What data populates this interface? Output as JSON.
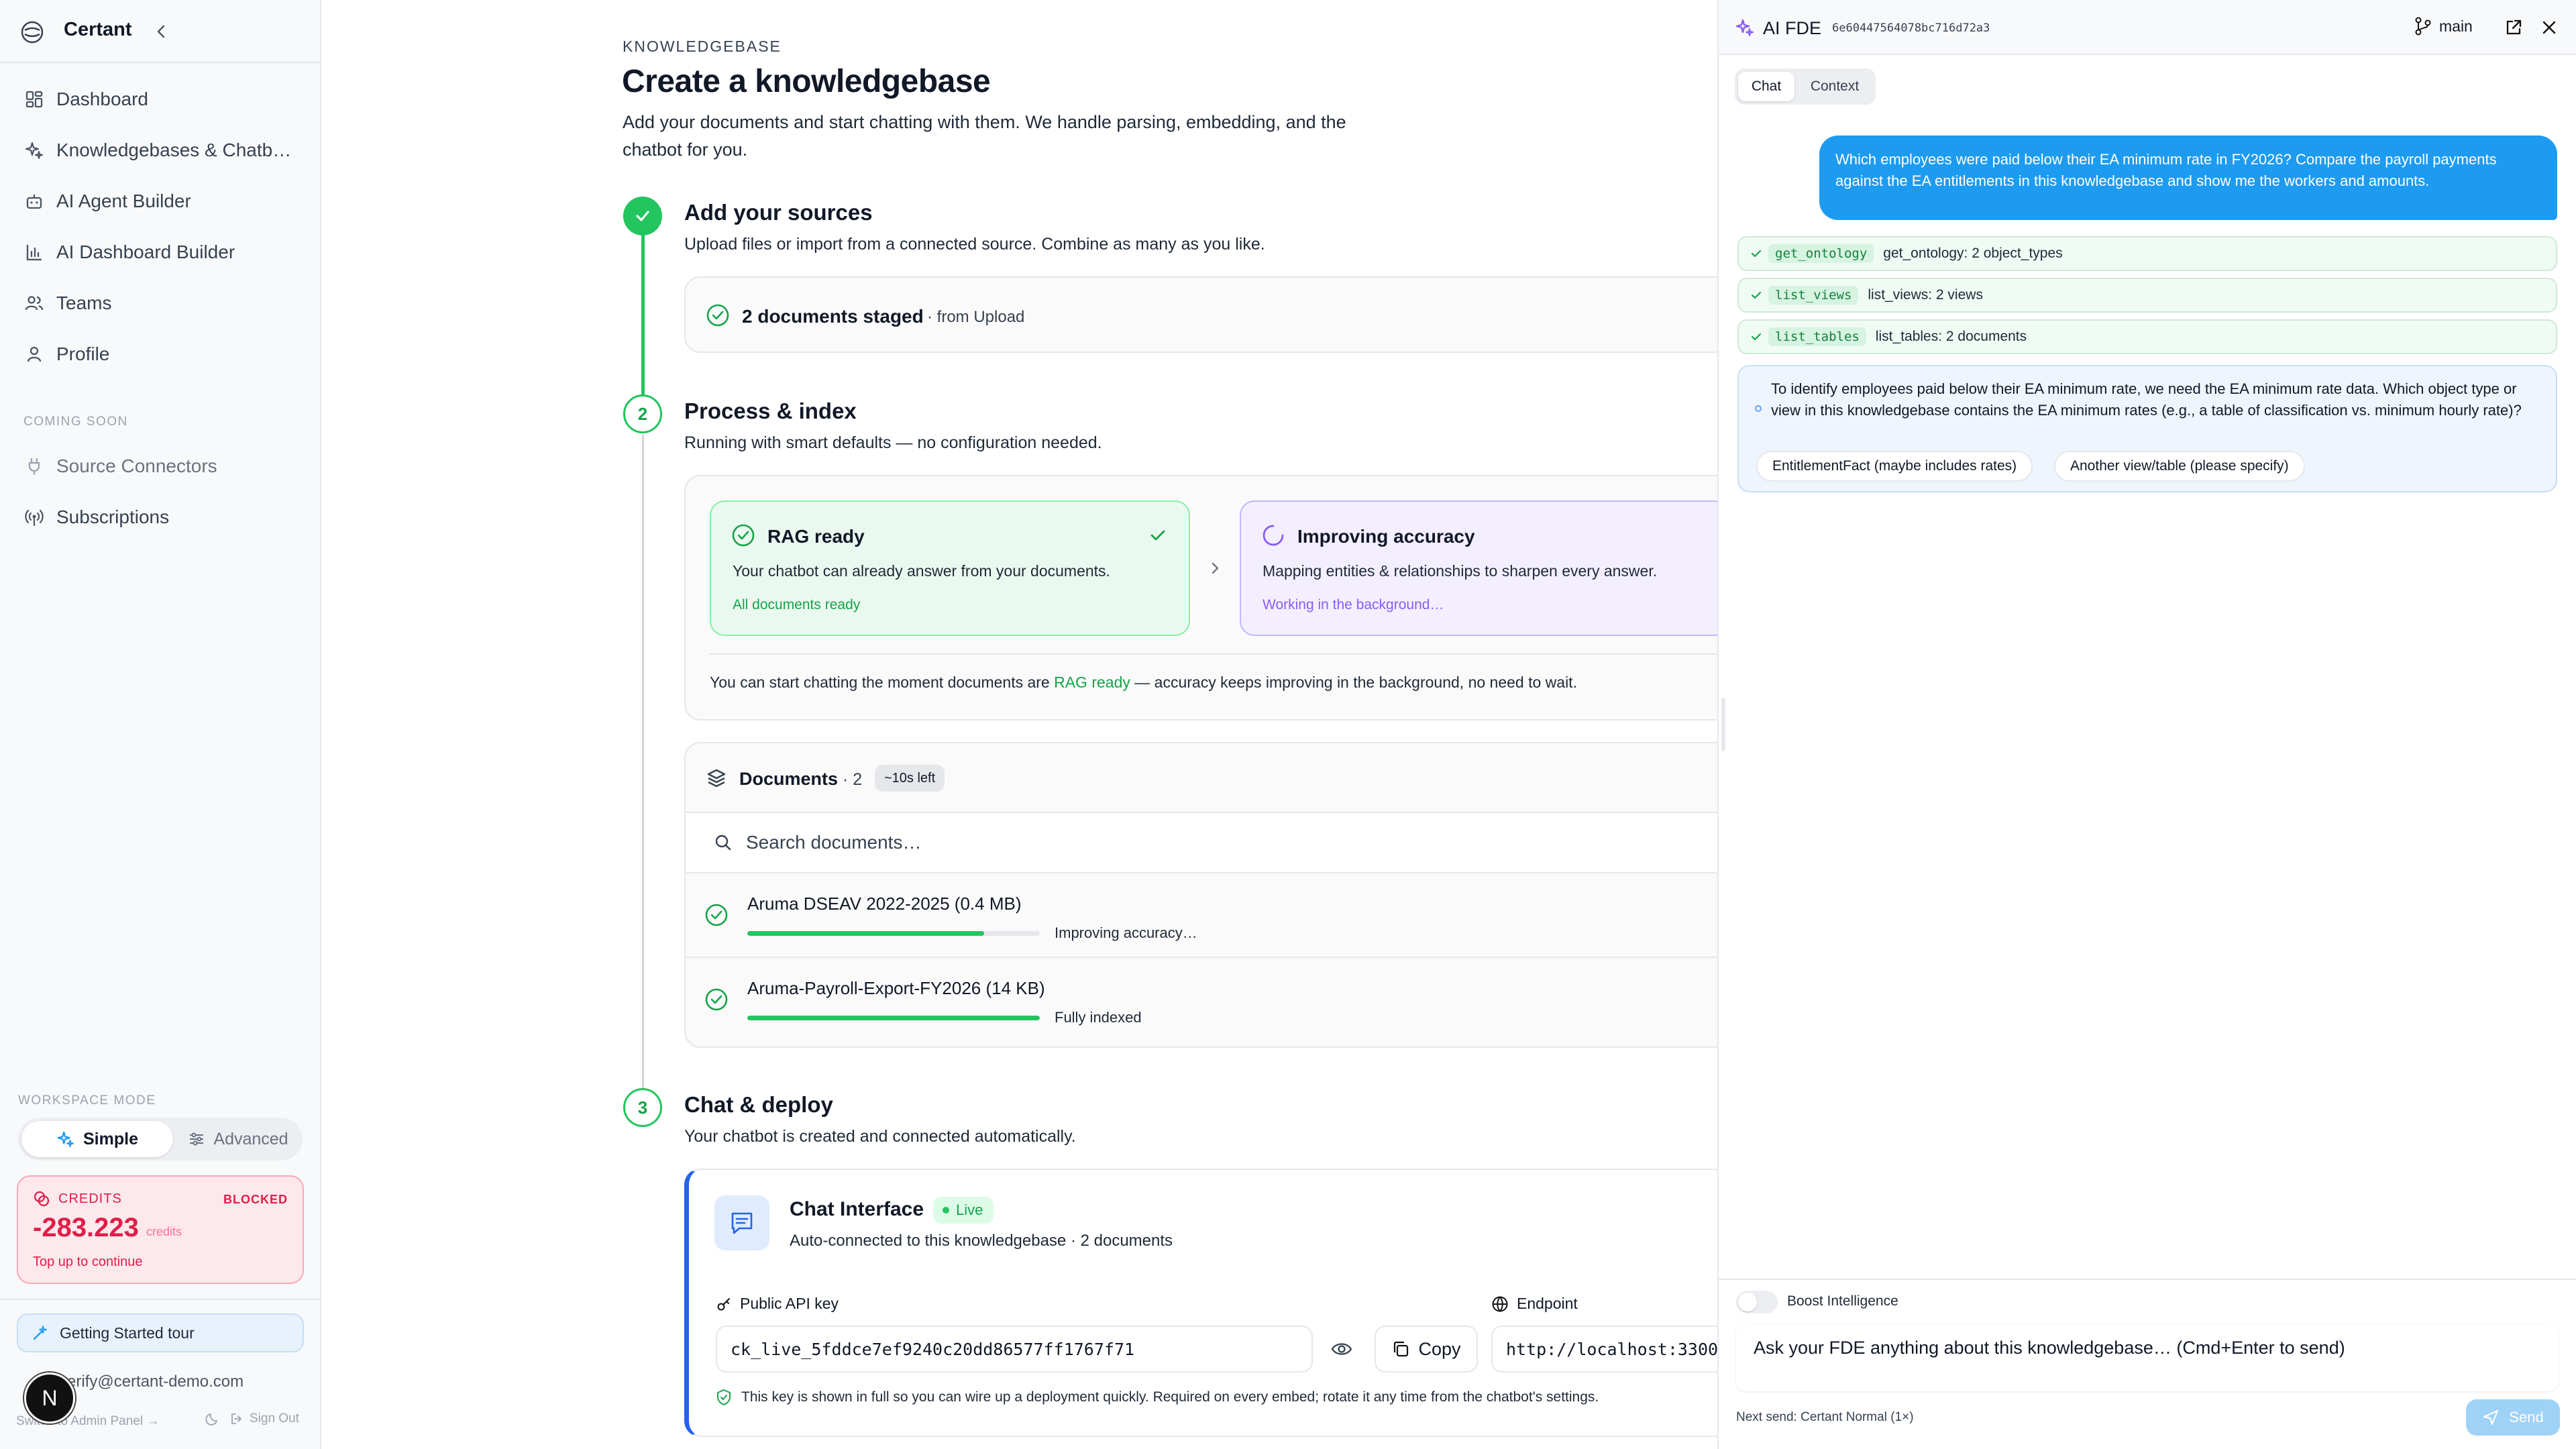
{
  "sidebar": {
    "brand": "Certant",
    "nav": [
      {
        "label": "Dashboard",
        "icon": "grid-icon"
      },
      {
        "label": "Knowledgebases & Chatb…",
        "icon": "sparkles-icon"
      },
      {
        "label": "AI Agent Builder",
        "icon": "bot-icon"
      },
      {
        "label": "AI Dashboard Builder",
        "icon": "chart-icon"
      },
      {
        "label": "Teams",
        "icon": "users-icon"
      },
      {
        "label": "Profile",
        "icon": "user-icon"
      }
    ],
    "coming_soon_label": "COMING SOON",
    "coming_soon": [
      {
        "label": "Source Connectors",
        "icon": "plug-icon"
      },
      {
        "label": "Subscriptions",
        "icon": "broadcast-icon"
      }
    ],
    "workspace_mode_label": "WORKSPACE MODE",
    "mode_simple": "Simple",
    "mode_advanced": "Advanced",
    "credits": {
      "label": "CREDITS",
      "status": "BLOCKED",
      "amount": "-283.223",
      "unit": "credits",
      "cta": "Top up to continue"
    },
    "tour_label": "Getting Started tour",
    "user_email": "verify@certant-demo.com",
    "admin_link": "Switch to Admin Panel →",
    "sign_out": "Sign Out",
    "avatar_letter": "N"
  },
  "main": {
    "kicker": "KNOWLEDGEBASE",
    "title": "Create a knowledgebase",
    "lead": "Add your documents and start chatting with them. We handle parsing, embedding, and the chatbot for you.",
    "step1": {
      "title": "Add your sources",
      "desc": "Upload files or import from a connected source. Combine as many as you like.",
      "staged": "2 documents staged",
      "staged_from": "· from Upload"
    },
    "step2": {
      "number": "2",
      "title": "Process & index",
      "desc": "Running with smart defaults — no configuration needed.",
      "rag_title": "RAG ready",
      "rag_desc": "Your chatbot can already answer from your documents.",
      "rag_status": "All documents ready",
      "acc_title": "Improving accuracy",
      "acc_desc": "Mapping entities & relationships to sharpen every answer.",
      "acc_status": "Working in the background…",
      "note_pre": "You can start chatting the moment documents are",
      "note_link": "RAG ready",
      "note_post": "— accuracy keeps improving in the background, no need to wait."
    },
    "documents": {
      "title": "Documents",
      "count": "· 2",
      "eta": "~10s left",
      "search_placeholder": "Search documents…",
      "rows": [
        {
          "name": "Aruma DSEAV 2022-2025 (0.4 MB)",
          "progress": 0.81,
          "status": "Improving accuracy…"
        },
        {
          "name": "Aruma-Payroll-Export-FY2026 (14 KB)",
          "progress": 1.0,
          "status": "Fully indexed"
        }
      ]
    },
    "step3": {
      "number": "3",
      "title": "Chat & deploy",
      "desc": "Your chatbot is created and connected automatically.",
      "chat_title": "Chat Interface",
      "live": "Live",
      "chat_sub": "Auto-connected to this knowledgebase · 2 documents",
      "api_label": "Public API key",
      "api_key": "ck_live_5fddce7ef9240c20dd86577ff1767f71",
      "copy": "Copy",
      "endpoint_label": "Endpoint",
      "endpoint": "http://localhost:3300",
      "key_note": "This key is shown in full so you can wire up a deployment quickly. Required on every embed; rotate it any time from the chatbot's settings."
    }
  },
  "fde": {
    "title": "AI FDE",
    "session_id": "6e60447564078bc716d72a3",
    "branch": "main",
    "tabs": [
      "Chat",
      "Context"
    ],
    "user_message": "Which employees were paid below their EA minimum rate in FY2026? Compare the payroll payments against the EA entitlements in this knowledgebase and show me the workers and amounts.",
    "tool_calls": [
      {
        "code": "get_ontology",
        "text": "get_ontology: 2 object_types"
      },
      {
        "code": "list_views",
        "text": "list_views: 2 views"
      },
      {
        "code": "list_tables",
        "text": "list_tables: 2 documents"
      }
    ],
    "question": "To identify employees paid below their EA minimum rate, we need the EA minimum rate data. Which object type or view in this knowledgebase contains the EA minimum rates (e.g., a table of classification vs. minimum hourly rate)?",
    "options": [
      "EntitlementFact (maybe includes rates)",
      "Another view/table (please specify)"
    ],
    "boost_label": "Boost Intelligence",
    "input_placeholder": "Ask your FDE anything about this knowledgebase… (Cmd+Enter to send)",
    "next_send": "Next send: Certant Normal (1×)",
    "send": "Send"
  },
  "colors": {
    "green": "#16a34a",
    "purple": "#8b5cf6",
    "blue": "#1d9bf0",
    "red": "#e11d48"
  }
}
